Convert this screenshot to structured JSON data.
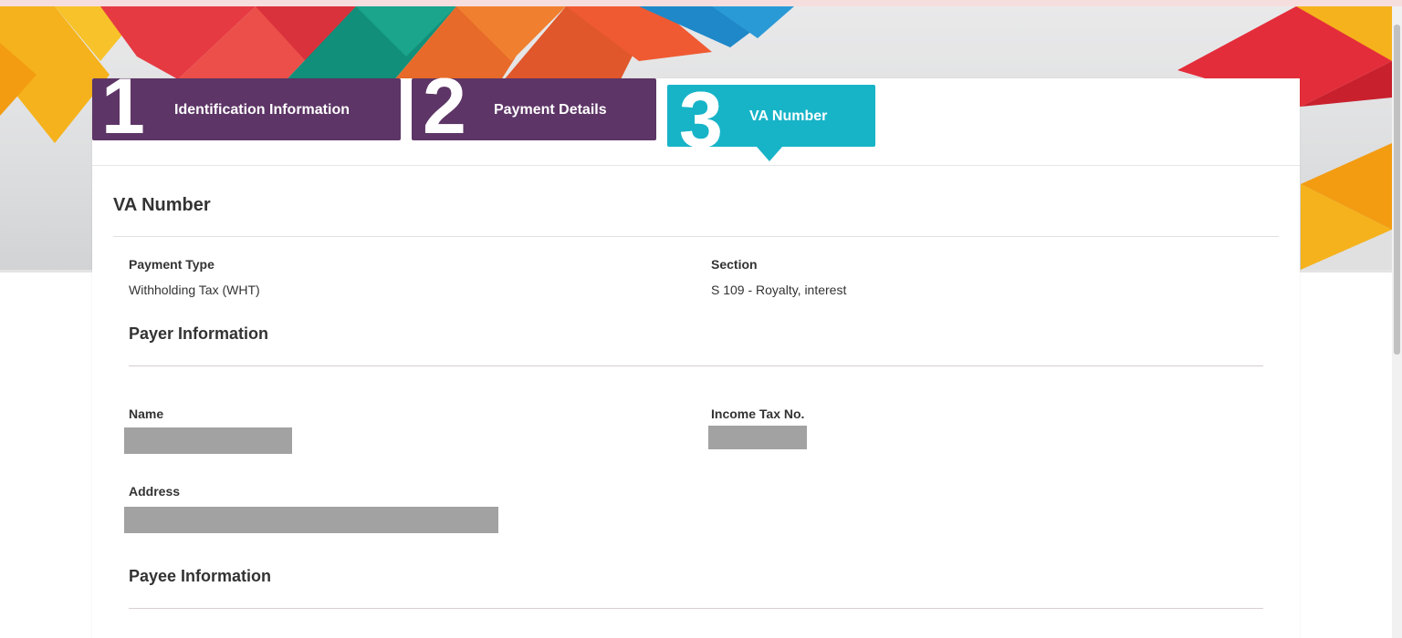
{
  "steps": [
    {
      "number": "1",
      "label": "Identification Information",
      "state": "completed"
    },
    {
      "number": "2",
      "label": "Payment Details",
      "state": "completed"
    },
    {
      "number": "3",
      "label": "VA Number",
      "state": "active"
    }
  ],
  "colors": {
    "step_completed": "#5d3566",
    "step_active": "#17b4c8"
  },
  "page": {
    "title": "VA Number"
  },
  "payment": {
    "type_label": "Payment Type",
    "type_value": "Withholding Tax (WHT)",
    "section_label": "Section",
    "section_value": "S 109 - Royalty, interest"
  },
  "payer": {
    "heading": "Payer Information",
    "name_label": "Name",
    "income_tax_label": "Income Tax No.",
    "address_label": "Address"
  },
  "payee": {
    "heading": "Payee Information"
  }
}
